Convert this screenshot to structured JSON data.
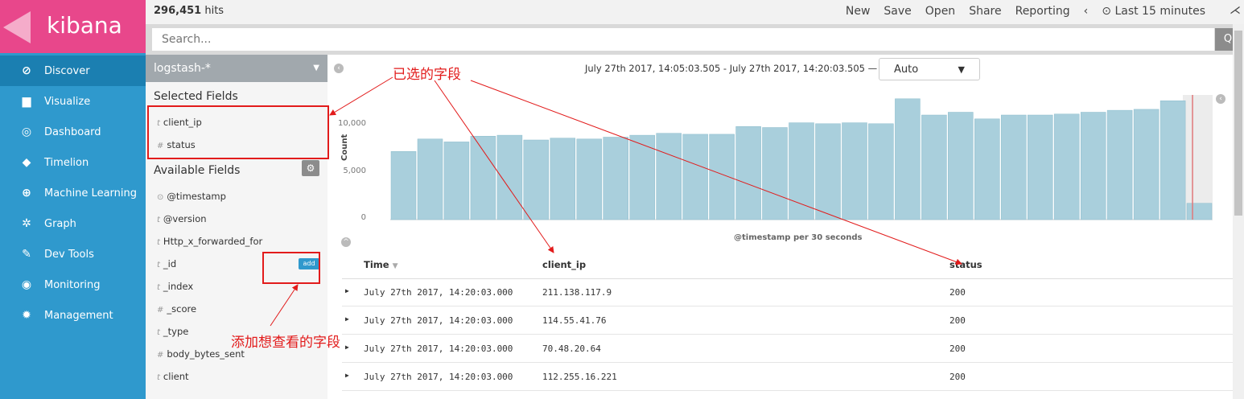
{
  "app": {
    "name": "kibana"
  },
  "nav": [
    {
      "label": "Discover",
      "icon": "compass-icon",
      "glyph": "⊘"
    },
    {
      "label": "Visualize",
      "icon": "bar-chart-icon",
      "glyph": "▆"
    },
    {
      "label": "Dashboard",
      "icon": "dashboard-icon",
      "glyph": "◎"
    },
    {
      "label": "Timelion",
      "icon": "timelion-icon",
      "glyph": "◆"
    },
    {
      "label": "Machine Learning",
      "icon": "machine-learning-icon",
      "glyph": "⊕"
    },
    {
      "label": "Graph",
      "icon": "graph-icon",
      "glyph": "✲"
    },
    {
      "label": "Dev Tools",
      "icon": "wrench-icon",
      "glyph": "✎"
    },
    {
      "label": "Monitoring",
      "icon": "eye-icon",
      "glyph": "◉"
    },
    {
      "label": "Management",
      "icon": "gear-icon",
      "glyph": "✹"
    }
  ],
  "topbar": {
    "hits_count": "296,451",
    "hits_label": "hits",
    "menu": [
      "New",
      "Save",
      "Open",
      "Share",
      "Reporting"
    ],
    "time_prev": "‹",
    "time_label": "⊙ Last 15 minutes",
    "collapse": "⋌"
  },
  "search": {
    "placeholder": "Search...",
    "button_icon": "search-icon",
    "button_glyph": "Q"
  },
  "fields": {
    "index_pattern": "logstash-*",
    "selected_title": "Selected Fields",
    "selected": [
      {
        "type": "t",
        "name": "client_ip"
      },
      {
        "type": "#",
        "name": "status"
      }
    ],
    "available_title": "Available Fields",
    "available": [
      {
        "type": "⊙",
        "name": "@timestamp"
      },
      {
        "type": "t",
        "name": "@version"
      },
      {
        "type": "t",
        "name": "Http_x_forwarded_for"
      },
      {
        "type": "t",
        "name": "_id",
        "add": "add"
      },
      {
        "type": "t",
        "name": "_index"
      },
      {
        "type": "#",
        "name": "_score"
      },
      {
        "type": "t",
        "name": "_type"
      },
      {
        "type": "#",
        "name": "body_bytes_sent"
      },
      {
        "type": "t",
        "name": "client"
      }
    ]
  },
  "histogram": {
    "time_range": "July 27th 2017, 14:05:03.505 - July 27th 2017, 14:20:03.505 —",
    "interval": "Auto",
    "bar_color": "#a9cfdc"
  },
  "chart_data": {
    "type": "bar",
    "ylabel": "Count",
    "xlabel": "@timestamp per 30 seconds",
    "ylim": [
      0,
      13000
    ],
    "yticks": [
      "0",
      "5,000",
      "10,000"
    ],
    "values": [
      7100,
      8400,
      8100,
      8700,
      8800,
      8300,
      8500,
      8400,
      8600,
      8800,
      9000,
      8900,
      8900,
      9700,
      9600,
      10100,
      10000,
      10100,
      10000,
      12600,
      10900,
      11200,
      10500,
      10900,
      10900,
      11000,
      11200,
      11400,
      11500,
      12400,
      1700
    ]
  },
  "table": {
    "headers": [
      "Time",
      "client_ip",
      "status"
    ],
    "rows": [
      {
        "time": "July 27th 2017, 14:20:03.000",
        "client_ip": "211.138.117.9",
        "status": "200"
      },
      {
        "time": "July 27th 2017, 14:20:03.000",
        "client_ip": "114.55.41.76",
        "status": "200"
      },
      {
        "time": "July 27th 2017, 14:20:03.000",
        "client_ip": "70.48.20.64",
        "status": "200"
      },
      {
        "time": "July 27th 2017, 14:20:03.000",
        "client_ip": "112.255.16.221",
        "status": "200"
      }
    ]
  },
  "annotations": {
    "selected_note": "已选的字段",
    "add_note": "添加想查看的字段",
    "color": "#e21b1b"
  }
}
